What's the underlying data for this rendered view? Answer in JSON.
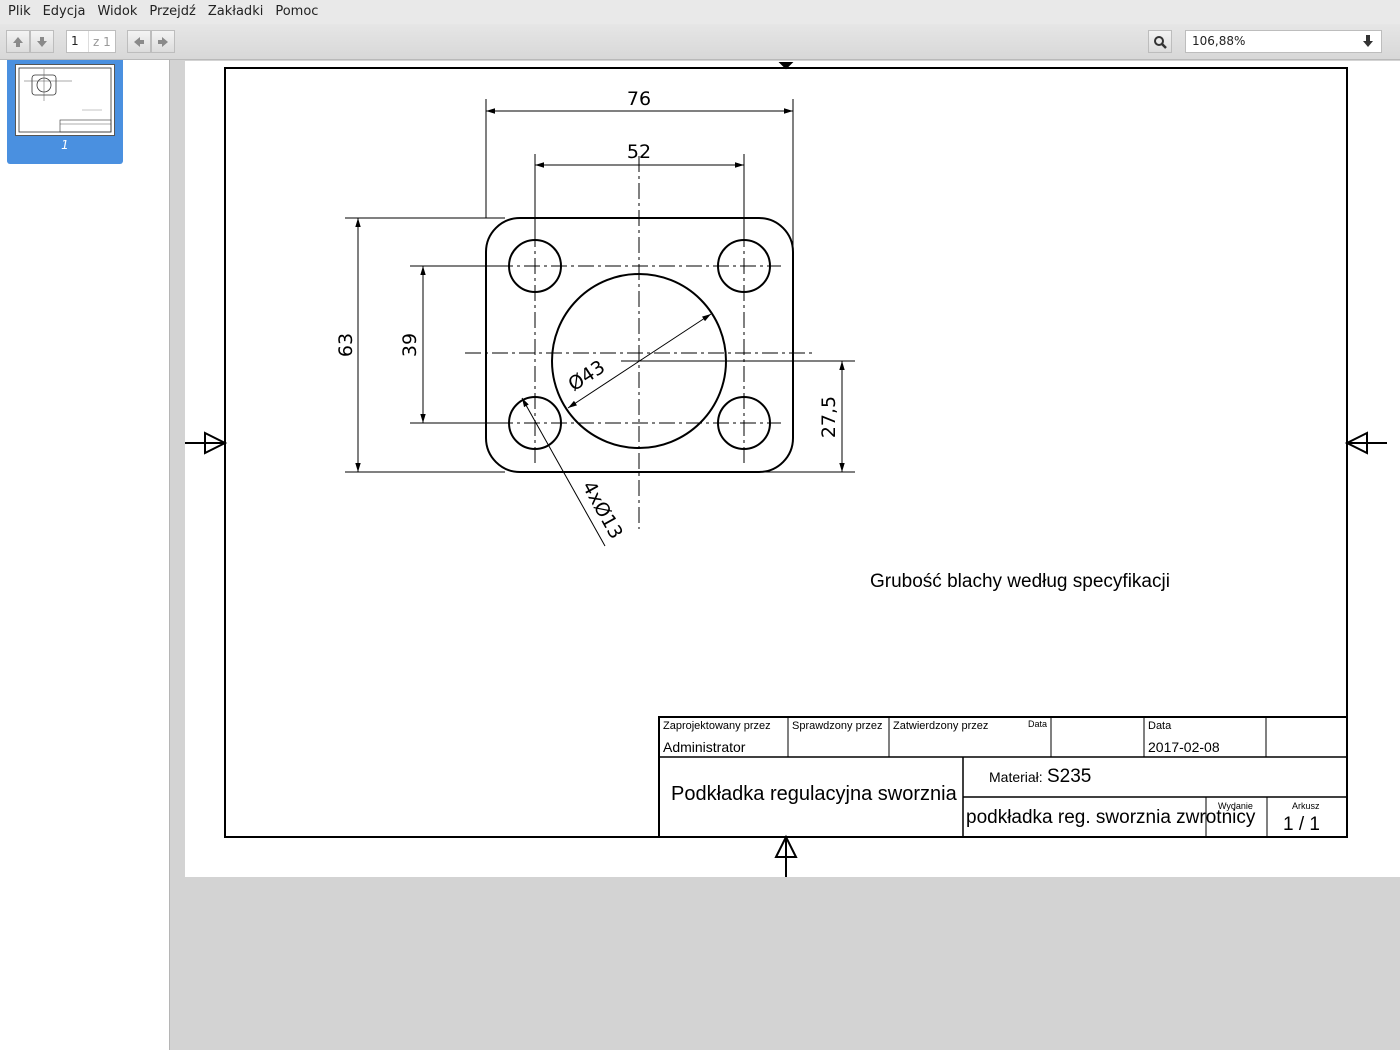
{
  "menubar": {
    "items": [
      "Plik",
      "Edycja",
      "Widok",
      "Przejdź",
      "Zakładki",
      "Pomoc"
    ]
  },
  "toolbar": {
    "page_current": "1",
    "page_total": "z 1",
    "zoom": "106,88%",
    "icons": [
      "arrow-up-icon",
      "arrow-down-icon",
      "back-icon",
      "forward-icon",
      "search-icon",
      "chevron-down-icon"
    ]
  },
  "sidebar": {
    "thumbnail_label": "1"
  },
  "drawing": {
    "dimensions": {
      "width_outer": "76",
      "width_inner": "52",
      "height_outer": "63",
      "height_inner": "39",
      "offset": "27,5",
      "center_hole": "Ø43",
      "corner_holes": "4xØ13"
    },
    "note": "Grubość blachy według specyfikacji",
    "title_block": {
      "designed_by_label": "Zaprojektowany przez",
      "designed_by": "Administrator",
      "checked_by_label": "Sprawdzony przez",
      "approved_by_label": "Zatwierdzony przez",
      "date_small_label": "Data",
      "date_label": "Data",
      "date": "2017-02-08",
      "title": "Podkładka regulacyjna sworznia",
      "material_label": "Materiał:",
      "material": "S235",
      "drawing_name": "podkładka reg. sworznia zwrotnicy",
      "issue_label": "Wydanie",
      "sheet_label": "Arkusz",
      "sheet": "1 / 1"
    }
  },
  "colors": {
    "selection": "#4a90e0",
    "background": "#d3d3d3"
  }
}
